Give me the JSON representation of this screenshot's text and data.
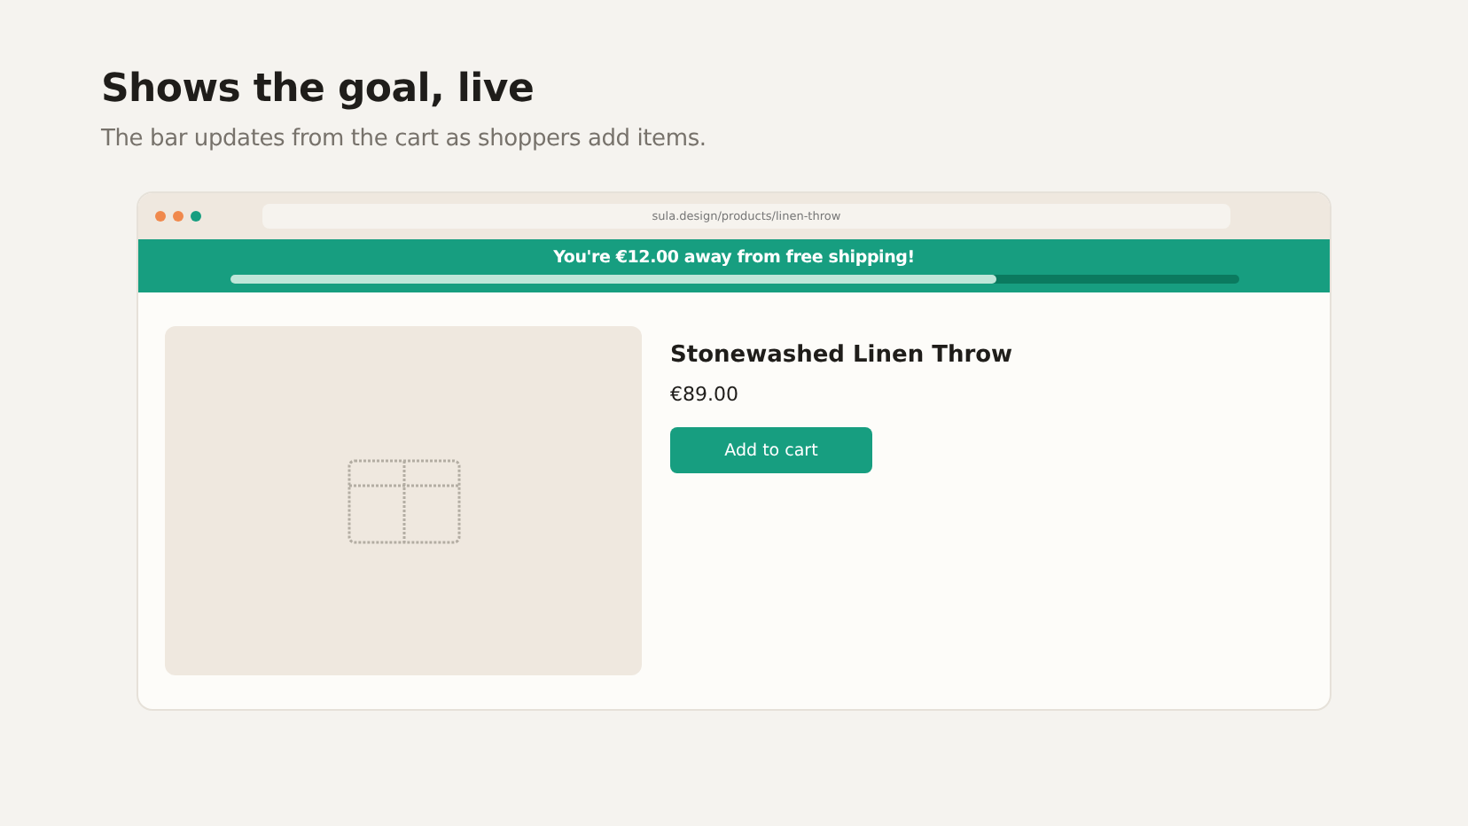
{
  "heading": "Shows the goal, live",
  "subtitle": "The bar updates from the cart as shoppers add items.",
  "browser": {
    "url": "sula.design/products/linen-throw"
  },
  "banner": {
    "message": "You're €12.00 away from free shipping!",
    "level": 0.76
  },
  "product": {
    "name": "Stonewashed Linen Throw",
    "price": "€89.00",
    "button": "Add to cart"
  }
}
